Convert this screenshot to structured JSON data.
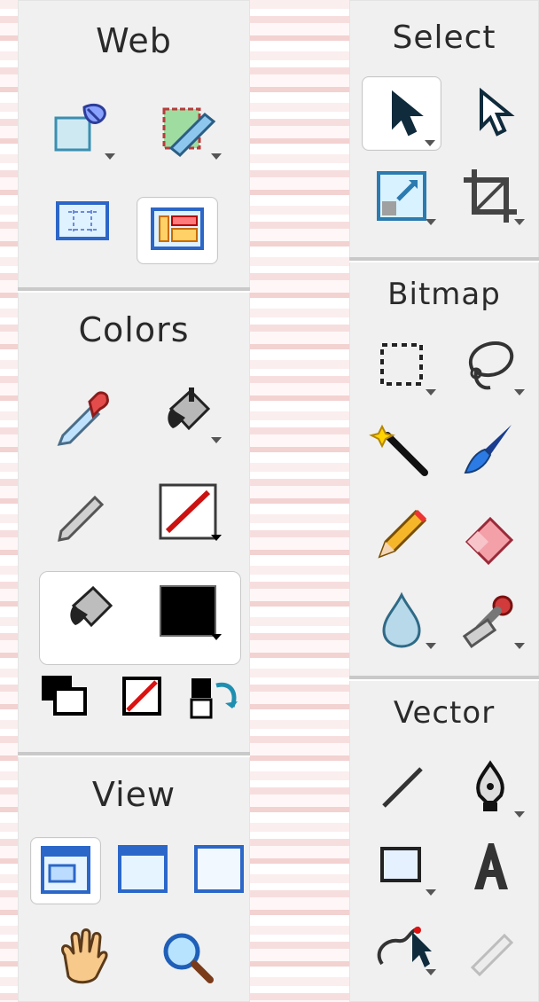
{
  "left_panel": {
    "web": {
      "title": "Web"
    },
    "colors": {
      "title": "Colors"
    },
    "view": {
      "title": "View"
    }
  },
  "right_panel": {
    "select": {
      "title": "Select"
    },
    "bitmap": {
      "title": "Bitmap"
    },
    "vector": {
      "title": "Vector"
    }
  },
  "tools": {
    "web": [
      "hotspot-tool",
      "slice-tool",
      "hide-slices",
      "show-slices"
    ],
    "colors": [
      "eyedropper-tool",
      "paint-bucket-tool",
      "stroke-color",
      "fill-color",
      "default-colors",
      "no-stroke-or-fill",
      "swap-colors"
    ],
    "view": [
      "standard-screen-mode",
      "maximized-screen-mode",
      "full-screen-mode",
      "hand-tool",
      "zoom-tool"
    ],
    "select": [
      "pointer-tool",
      "subselection-tool",
      "scale-tool",
      "crop-tool"
    ],
    "bitmap": [
      "marquee-tool",
      "lasso-tool",
      "magic-wand-tool",
      "brush-tool",
      "pencil-tool",
      "eraser-tool",
      "blur-tool",
      "rubber-stamp-tool"
    ],
    "vector": [
      "line-tool",
      "pen-tool",
      "rectangle-tool",
      "text-tool",
      "freeform-tool",
      "knife-tool"
    ]
  },
  "colors": {
    "panel_bg": "#f0f0f0",
    "stroke_color": "#cc1111",
    "fill_color": "#000000"
  }
}
